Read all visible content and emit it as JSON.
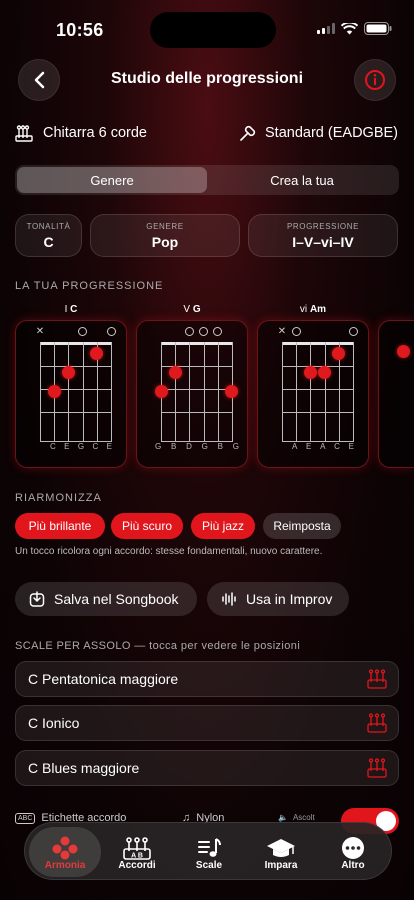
{
  "status": {
    "time": "10:56"
  },
  "header": {
    "title": "Studio delle progressioni"
  },
  "instrument": {
    "name": "Chitarra 6 corde",
    "tuning": "Standard (EADGBE)"
  },
  "segmented": {
    "tabs": [
      "Genere",
      "Crea la tua"
    ],
    "selected": "Genere"
  },
  "pills": [
    {
      "label": "TONALITÀ",
      "value": "C"
    },
    {
      "label": "GENERE",
      "value": "Pop"
    },
    {
      "label": "PROGRESSIONE",
      "value": "I–V–vi–IV"
    }
  ],
  "progression": {
    "section_title": "LA TUA PROGRESSIONE",
    "chords": [
      {
        "numeral": "I",
        "name": "C",
        "notes": [
          "C",
          "E",
          "G",
          "C",
          "E"
        ]
      },
      {
        "numeral": "V",
        "name": "G",
        "notes": [
          "G",
          "B",
          "D",
          "G",
          "B",
          "G"
        ]
      },
      {
        "numeral": "vi",
        "name": "Am",
        "notes": [
          "A",
          "E",
          "A",
          "C",
          "E"
        ]
      }
    ]
  },
  "reharm": {
    "section_title": "RIARMONIZZA",
    "chips": [
      "Più brillante",
      "Più scuro",
      "Più jazz",
      "Reimposta"
    ],
    "hint": "Un tocco ricolora ogni accordo: stesse fondamentali, nuovo carattere."
  },
  "actions": {
    "save": "Salva nel Songbook",
    "improv": "Usa in Improv"
  },
  "scales": {
    "section_title": "SCALE PER ASSOLO — tocca per vedere le posizioni",
    "items": [
      "C Pentatonica maggiore",
      "C Ionico",
      "C Blues maggiore"
    ]
  },
  "settings": {
    "chord_labels": "Etichette accordo",
    "sound": "Nylon",
    "listen": "Ascolt"
  },
  "tabbar": {
    "tabs": [
      "Armonia",
      "Accordi",
      "Scale",
      "Impara",
      "Altro"
    ],
    "selected": "Armonia"
  },
  "colors": {
    "accent": "#e1161d",
    "accent_text": "#e63a3a"
  }
}
